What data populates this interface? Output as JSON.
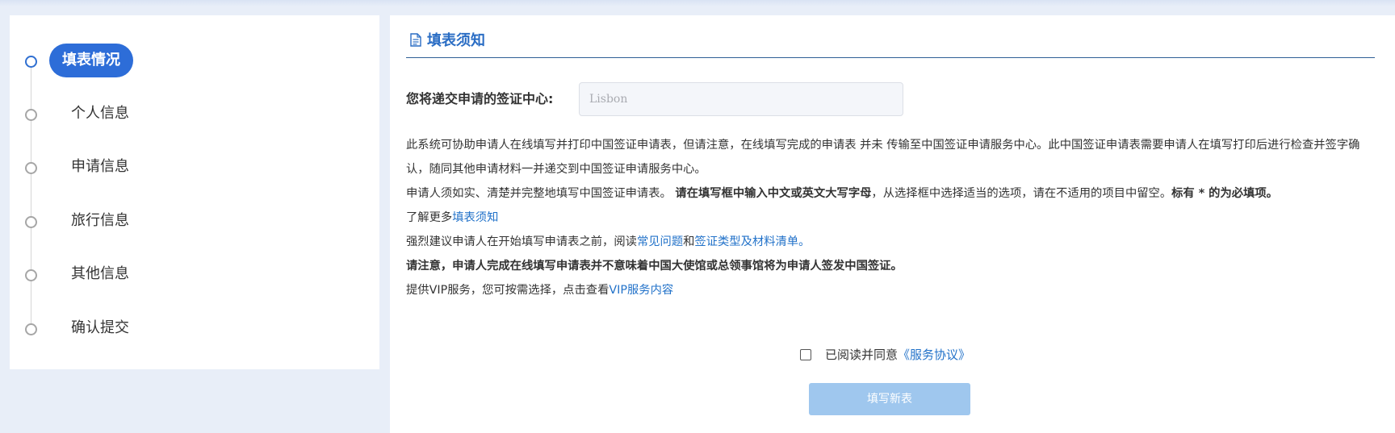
{
  "sidebar": {
    "steps": [
      {
        "label": "填表情况",
        "active": true
      },
      {
        "label": "个人信息",
        "active": false
      },
      {
        "label": "申请信息",
        "active": false
      },
      {
        "label": "旅行信息",
        "active": false
      },
      {
        "label": "其他信息",
        "active": false
      },
      {
        "label": "确认提交",
        "active": false
      }
    ]
  },
  "main": {
    "section_title": "填表须知",
    "center_label": "您将递交申请的签证中心:",
    "center_value": "Lisbon",
    "notice": {
      "p1": "此系统可协助申请人在线填写并打印中国签证申请表，但请注意，在线填写完成的申请表 并未 传输至中国签证申请服务中心。此中国签证申请表需要申请人在填写打印后进行检查并签字确认，随同其他申请材料一并递交到中国签证申请服务中心。",
      "p2_a": "申请人须如实、清楚并完整地填写中国签证申请表。",
      "p2_b": "请在填写框中输入中文或英文大写字母",
      "p2_c": "，从选择框中选择适当的选项，请在不适用的项目中留空。",
      "p2_d": "标有 * 的为必填项。",
      "p3_a": "了解更多",
      "p3_link": "填表须知",
      "p4_a": "强烈建议申请人在开始填写申请表之前，阅读",
      "p4_link1": "常见问题",
      "p4_mid": "和",
      "p4_link2": "签证类型及材料清单。",
      "p5": "请注意，申请人完成在线填写申请表并不意味着中国大使馆或总领事馆将为申请人签发中国签证。",
      "p6_a": "提供VIP服务，您可按需选择，点击查看",
      "p6_link": "VIP服务内容"
    },
    "agree_text": "已阅读并同意",
    "agree_link": "《服务协议》",
    "new_form_button": "填写新表"
  }
}
